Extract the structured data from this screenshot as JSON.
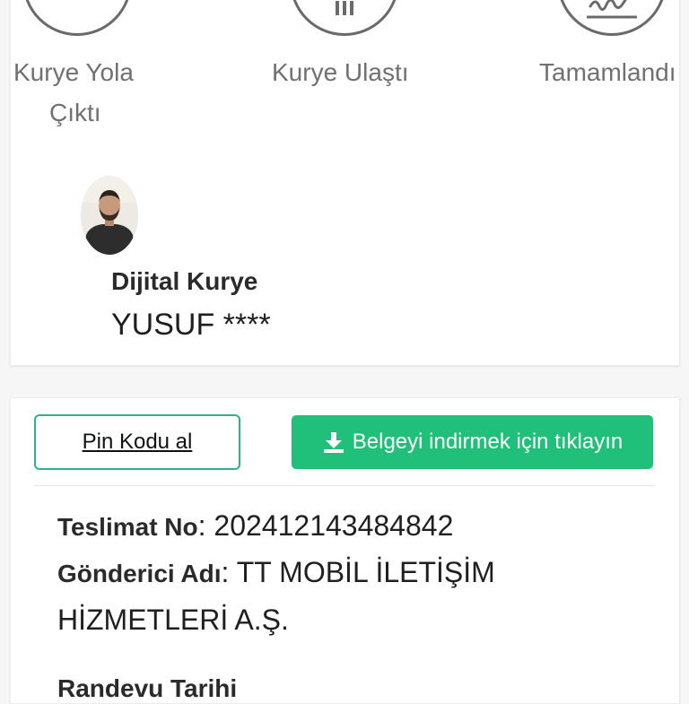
{
  "steps": [
    {
      "label_line1": "Kurye Yola",
      "label_line2": "Çıktı",
      "icon": "scooter-icon"
    },
    {
      "label_line1": "Kurye Ulaştı",
      "icon": "building-icon"
    },
    {
      "label_line1": "Tamamlandı",
      "icon": "signature-icon"
    }
  ],
  "courier": {
    "title": "Dijital Kurye",
    "name": "YUSUF ****"
  },
  "actions": {
    "pin_label": "Pin Kodu al",
    "document_label": "Belgeyi indirmek için tıklayın"
  },
  "details": {
    "delivery_no_key": "Teslimat No",
    "delivery_no_value": ": 202412143484842",
    "sender_key": "Gönderici Adı",
    "sender_value_line1": ": TT MOBİL İLETİŞİM",
    "sender_value_line2": "HİZMETLERİ A.Ş.",
    "appointment_key": "Randevu Tarihi"
  },
  "colors": {
    "accent_green": "#21c07a",
    "outline_green": "#2eb388"
  }
}
